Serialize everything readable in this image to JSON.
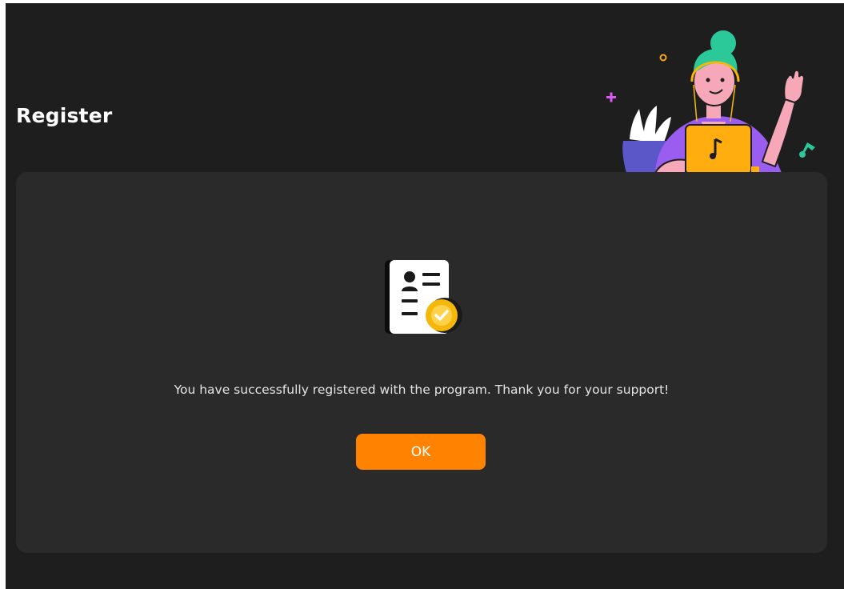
{
  "header": {
    "title": "Register"
  },
  "dialog": {
    "icon": "registration-certificate-check-icon",
    "message": "You have successfully registered with the program. Thank you for your support!",
    "ok_label": "OK"
  },
  "colors": {
    "background": "#1e1e1f",
    "card": "#2a2a2b",
    "accent": "#ff8200",
    "badge": "#f5b80a"
  }
}
